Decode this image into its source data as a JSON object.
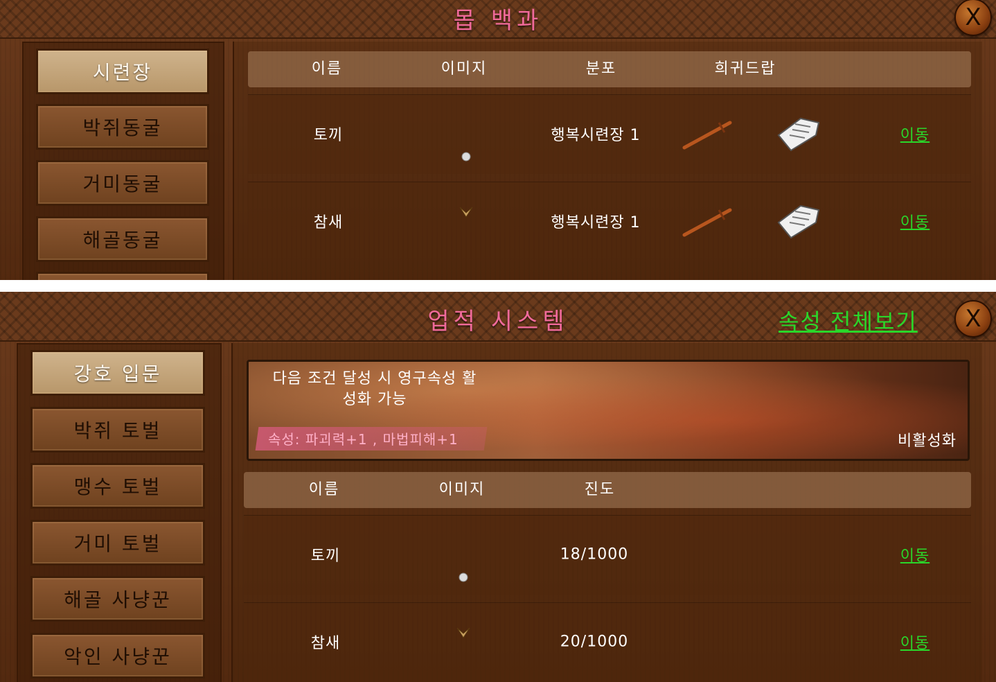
{
  "panel1": {
    "title": "몹 백과",
    "close_label": "X",
    "sidebar": [
      "시련장",
      "박쥐동굴",
      "거미동굴",
      "해골동굴"
    ],
    "headers": [
      "이름",
      "이미지",
      "분포",
      "희귀드랍"
    ],
    "rows": [
      {
        "name": "토끼",
        "location": "행복시련장 1",
        "action": "이동"
      },
      {
        "name": "참새",
        "location": "행복시련장 1",
        "action": "이동"
      }
    ]
  },
  "panel2": {
    "title": "업적 시스템",
    "view_all": "속성 전체보기",
    "close_label": "X",
    "sidebar": [
      "강호 입문",
      "박쥐 토벌",
      "맹수 토벌",
      "거미 토벌",
      "해골 사냥꾼",
      "악인 사냥꾼"
    ],
    "banner": {
      "line1": "다음 조건 달성 시 영구속성 활",
      "line2": "성화 가능",
      "attributes": "속성: 파괴력+1 , 마법피해+1",
      "status": "비활성화"
    },
    "headers": [
      "이름",
      "이미지",
      "진도"
    ],
    "rows": [
      {
        "name": "토끼",
        "progress": "18/1000",
        "action": "이동"
      },
      {
        "name": "참새",
        "progress": "20/1000",
        "action": "이동"
      }
    ]
  },
  "colors": {
    "title_pink": "#f06a9a",
    "link_green": "#2ad62a",
    "wood_brown": "#5e3216"
  }
}
